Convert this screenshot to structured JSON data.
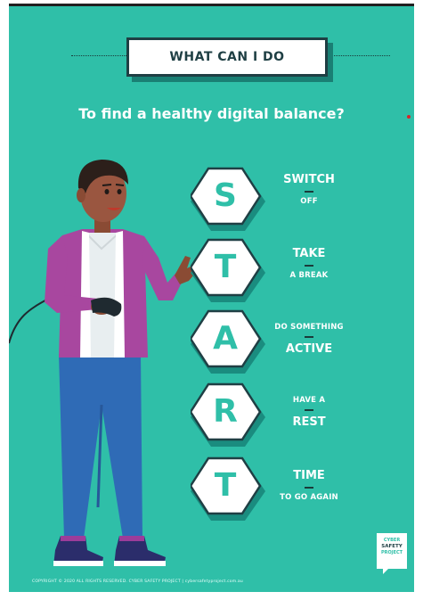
{
  "poster": {
    "title": "WHAT CAN I DO",
    "subtitle": "To find a healthy digital balance?",
    "steps": [
      {
        "letter": "S",
        "top": "SWITCH",
        "bottom": "OFF"
      },
      {
        "letter": "T",
        "top": "TAKE",
        "bottom": "A BREAK"
      },
      {
        "letter": "A",
        "top": "DO SOMETHING",
        "bottom": "ACTIVE"
      },
      {
        "letter": "R",
        "top": "HAVE A",
        "bottom": "REST"
      },
      {
        "letter": "T",
        "top": "TIME",
        "bottom": "TO GO AGAIN"
      }
    ],
    "footer": "COPYRIGHT © 2020 ALL RIGHTS RESERVED. CYBER SAFETY PROJECT | cybersafetyproject.com.au",
    "logo": {
      "line1": "CYBER",
      "line2": "SAFETY",
      "line3": "PROJECT"
    }
  },
  "colors": {
    "background": "#2fbfa8",
    "dark": "#1f3f44",
    "white": "#ffffff",
    "accent_red": "#d9252a"
  }
}
